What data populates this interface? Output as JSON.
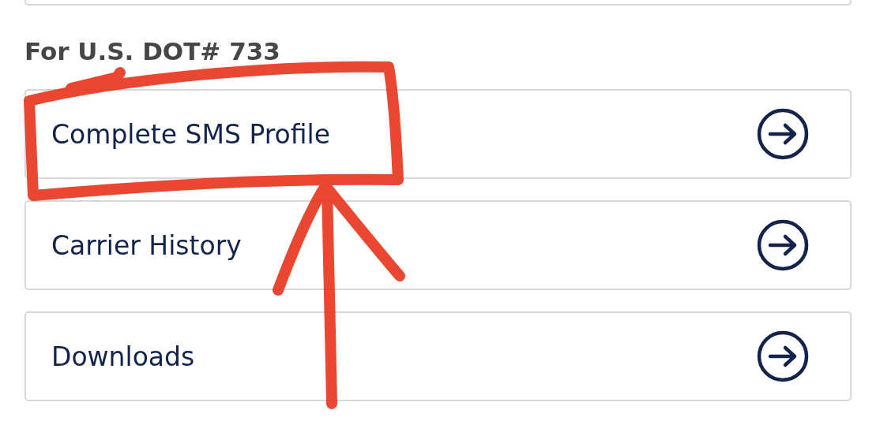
{
  "heading": "For U.S. DOT# 733",
  "links": [
    {
      "label": "Complete SMS Profile"
    },
    {
      "label": "Carrier History"
    },
    {
      "label": "Downloads"
    }
  ]
}
